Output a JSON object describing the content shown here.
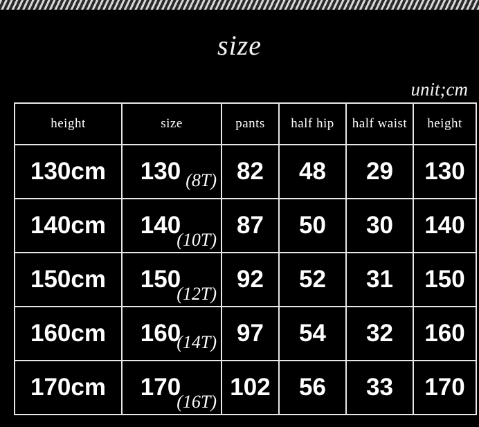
{
  "title": "size",
  "unit_note": "unit;cm",
  "table": {
    "headers": [
      "height",
      "size",
      "pants",
      "half hip",
      "half waist",
      "height"
    ],
    "rows": [
      {
        "height": "130cm",
        "size_num": "130",
        "size_t": "(8T)",
        "pants": "82",
        "half_hip": "48",
        "half_waist": "29",
        "height2": "130"
      },
      {
        "height": "140cm",
        "size_num": "140",
        "size_t": "(10T)",
        "pants": "87",
        "half_hip": "50",
        "half_waist": "30",
        "height2": "140"
      },
      {
        "height": "150cm",
        "size_num": "150",
        "size_t": "(12T)",
        "pants": "92",
        "half_hip": "52",
        "half_waist": "31",
        "height2": "150"
      },
      {
        "height": "160cm",
        "size_num": "160",
        "size_t": "(14T)",
        "pants": "97",
        "half_hip": "54",
        "half_waist": "32",
        "height2": "160"
      },
      {
        "height": "170cm",
        "size_num": "170",
        "size_t": "(16T)",
        "pants": "102",
        "half_hip": "56",
        "half_waist": "33",
        "height2": "170"
      }
    ]
  },
  "colors": {
    "background": "#000000",
    "text": "#ffffff",
    "border": "#e8e8e8"
  }
}
